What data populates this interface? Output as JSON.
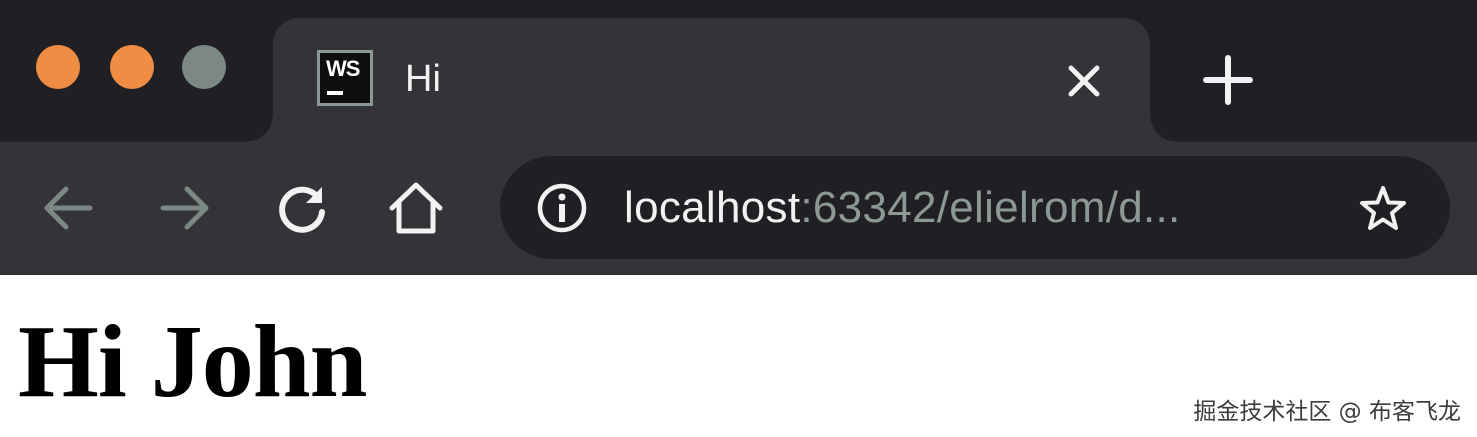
{
  "window": {
    "traffic_lights": [
      "#ef8d44",
      "#ef8d44",
      "#7b8883"
    ]
  },
  "tab": {
    "favicon_text": "WS",
    "favicon_icon": "webstorm-icon",
    "title": "Hi",
    "close_icon": "close-icon",
    "new_tab_icon": "plus-icon"
  },
  "toolbar": {
    "icons": [
      "back-arrow-icon",
      "forward-arrow-icon",
      "reload-icon",
      "home-icon"
    ],
    "address": {
      "info_icon": "info-icon",
      "host": "localhost",
      "rest": ":63342/elielrom/d...",
      "bookmark_icon": "star-icon"
    }
  },
  "page": {
    "heading": "Hi John"
  },
  "watermark": "掘金技术社区 @ 布客飞龙",
  "colors": {
    "titlebar": "#202024",
    "tab_and_toolbar": "#333338",
    "omnibox": "#202024",
    "url_host": "#f2f2f2",
    "url_muted": "#8c9893",
    "disabled_icon": "#7b8883"
  }
}
